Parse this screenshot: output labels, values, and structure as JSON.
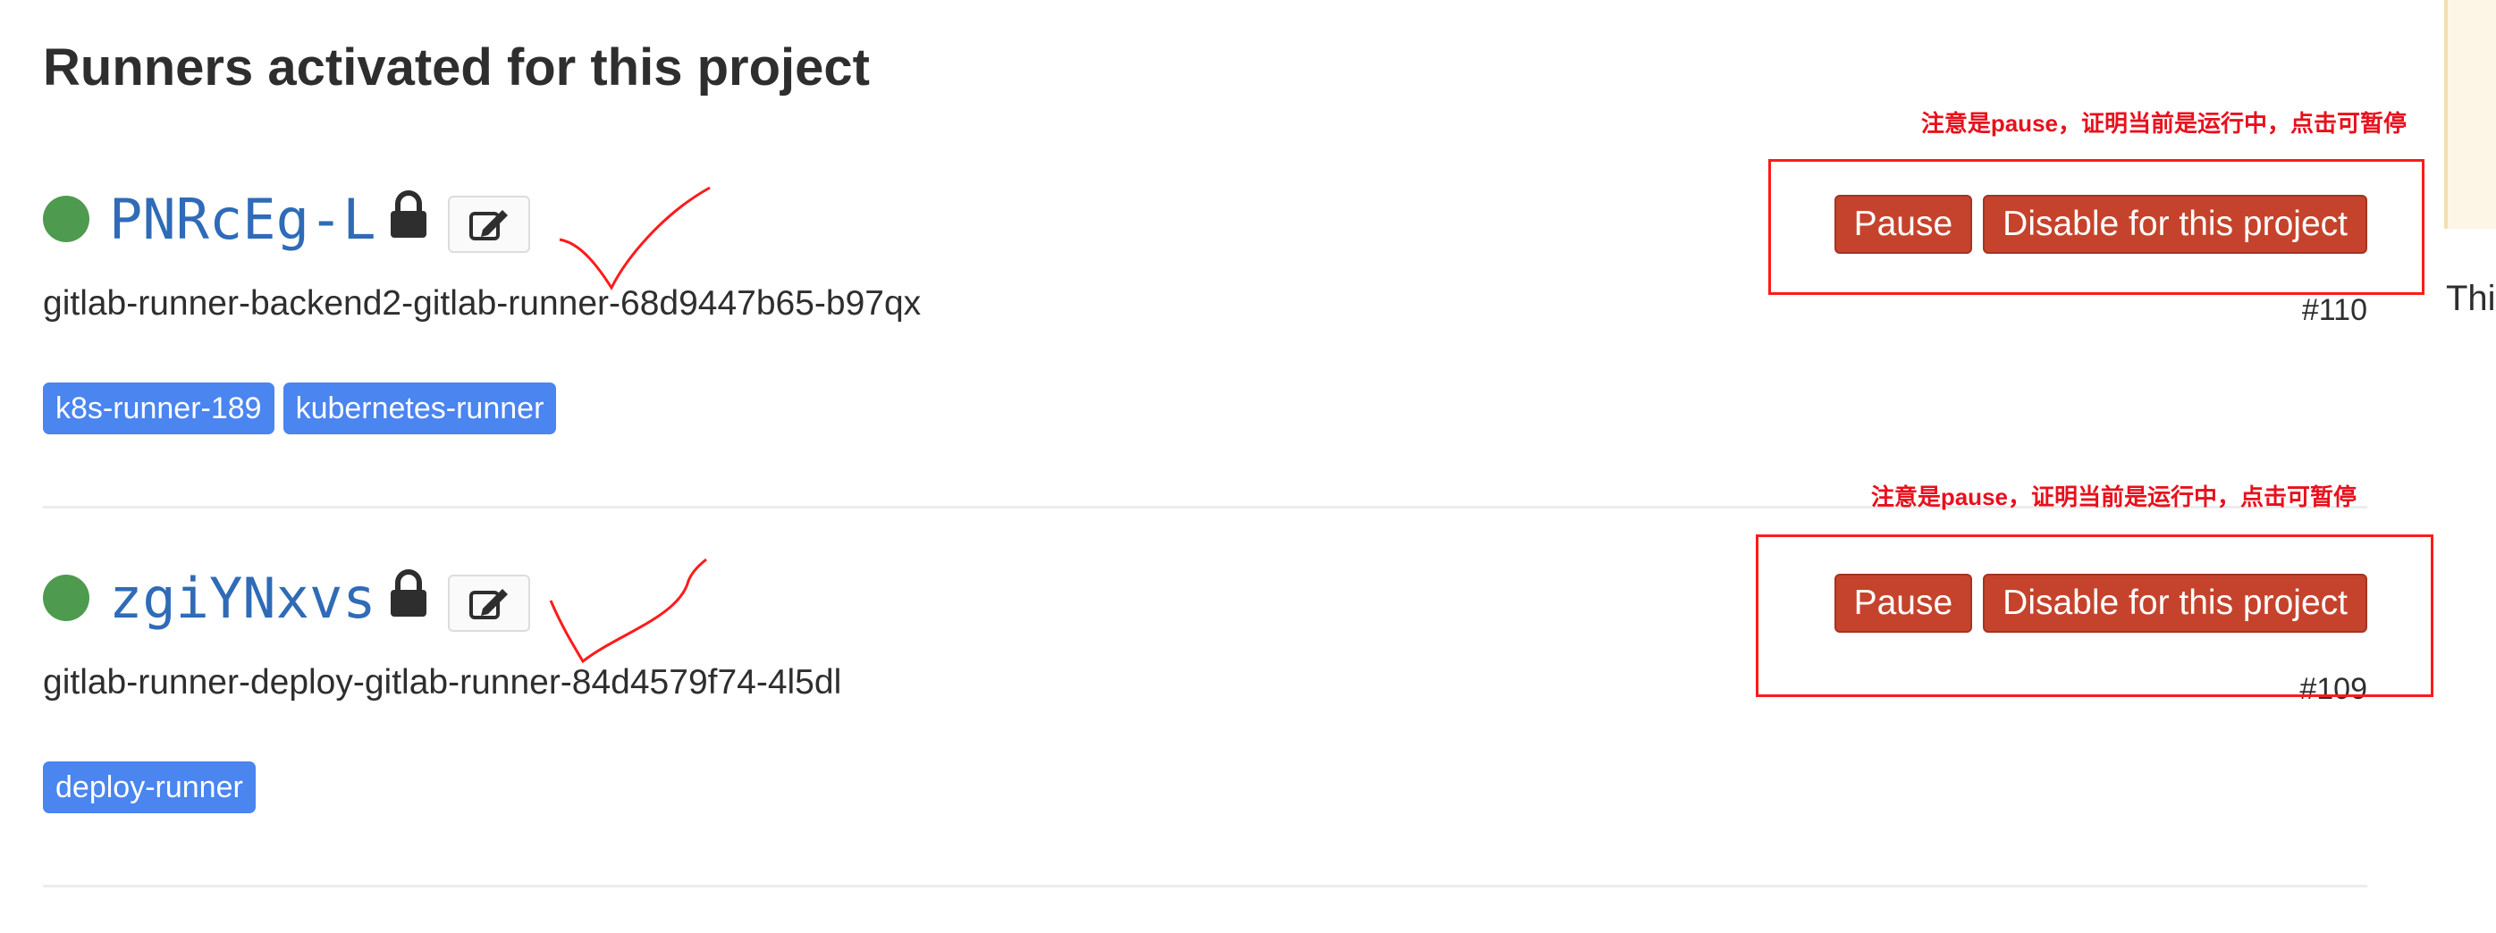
{
  "page": {
    "title": "Runners activated for this project"
  },
  "runners": [
    {
      "token": "PNRcEg-L",
      "description": "gitlab-runner-backend2-gitlab-runner-68d9447b65-b97qx",
      "id": "#110",
      "tags": [
        "k8s-runner-189",
        "kubernetes-runner"
      ],
      "pause_label": "Pause",
      "disable_label": "Disable for this project",
      "annotation": "注意是pause，证明当前是运行中，点击可暂停"
    },
    {
      "token": "zgiYNxvs",
      "description": "gitlab-runner-deploy-gitlab-runner-84d4579f74-4l5dl",
      "id": "#109",
      "tags": [
        "deploy-runner"
      ],
      "pause_label": "Pause",
      "disable_label": "Disable for this project",
      "annotation": "注意是pause，证明当前是运行中，点击可暂停"
    }
  ],
  "sidebar": {
    "clipped_text": "Thi"
  },
  "icons": {
    "status": "status-online-icon",
    "lock": "lock-icon",
    "edit": "pencil-square-icon"
  },
  "colors": {
    "status_online": "#4e9a4e",
    "token_link": "#2f6bb7",
    "tag_background": "#4a85f0",
    "danger_button": "#c5432c",
    "annotation_red": "#ff1a1a"
  }
}
